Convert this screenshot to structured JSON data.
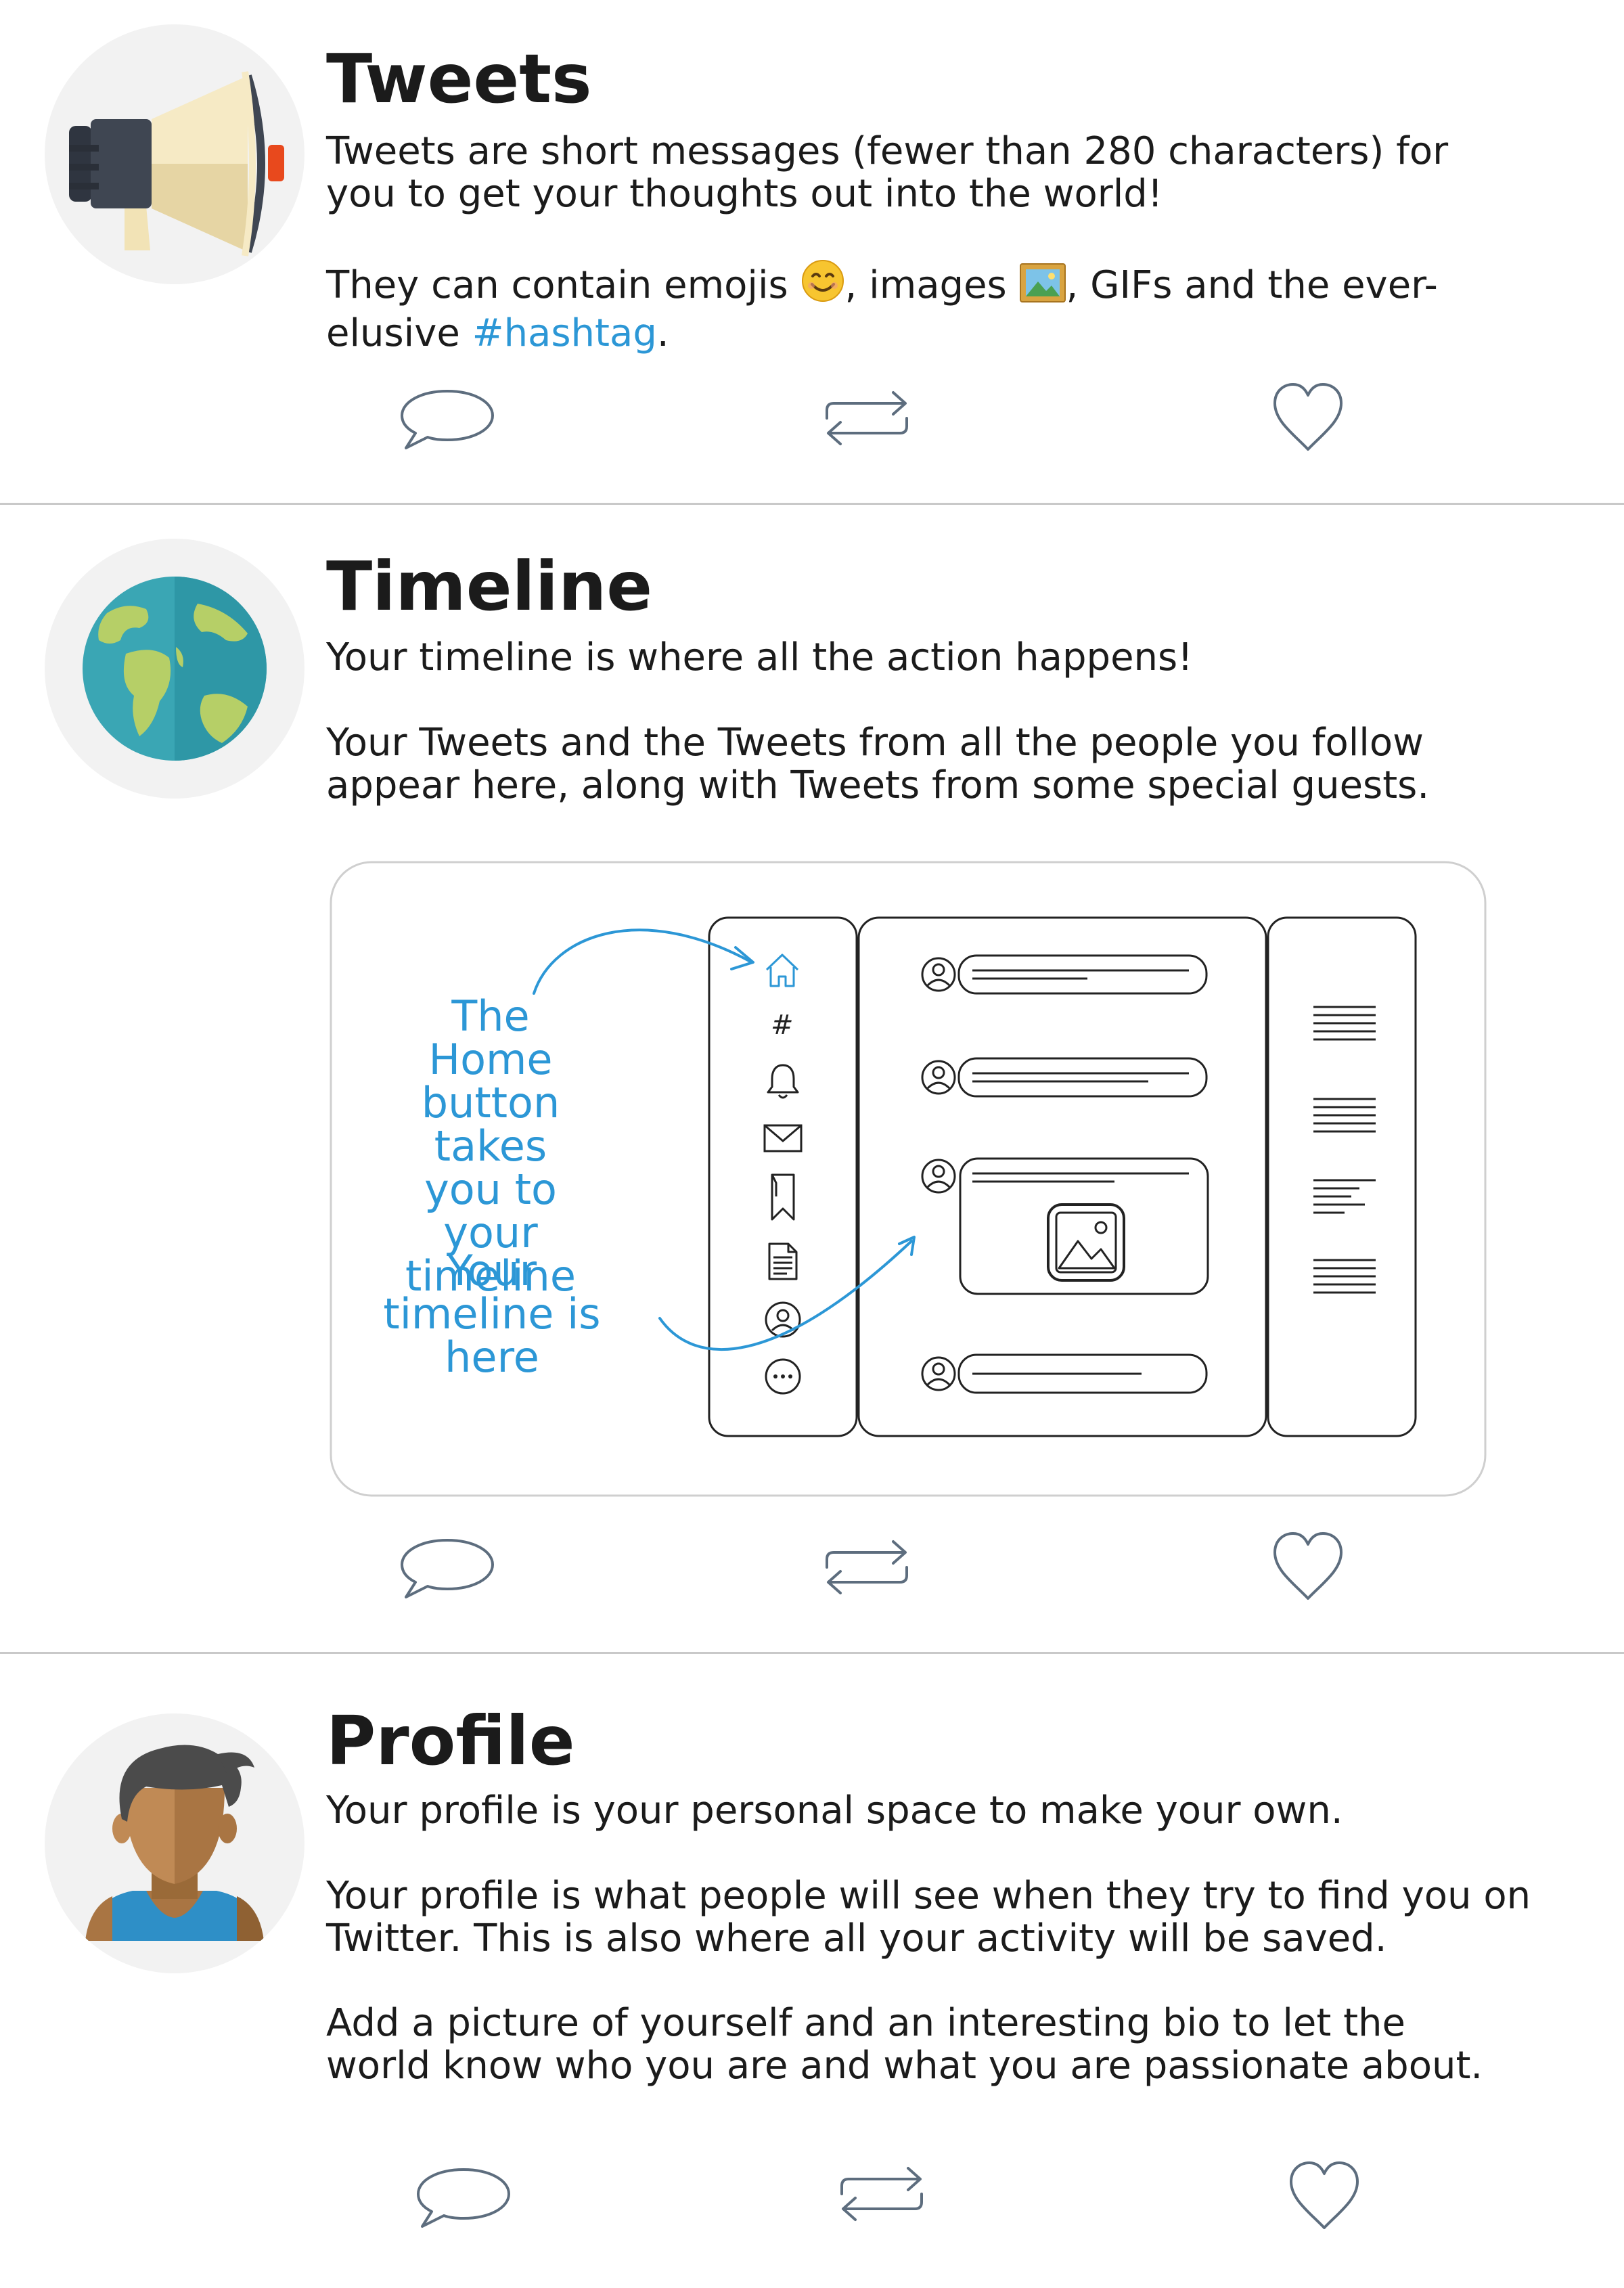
{
  "sections": {
    "tweets": {
      "title": "Tweets",
      "p1": "Tweets are short messages (fewer than 280 characters) for you to get your thoughts out into the world!",
      "p2_a": "They can contain emojis ",
      "p2_b": ", images ",
      "p2_c": ", GIFs and the ever-elusive ",
      "hashtag": "#hashtag",
      "p2_end": ".",
      "icon": "megaphone-icon"
    },
    "timeline": {
      "title": "Timeline",
      "p1": "Your timeline is where all the action happens!",
      "p2": "Your Tweets and the Tweets from all the people you follow appear here, along with Tweets from some special guests.",
      "icon": "globe-icon",
      "diagram": {
        "callout_home": "The Home button takes you to your timeline",
        "callout_timeline": "Your timeline is here",
        "nav_hashtag": "#"
      }
    },
    "profile": {
      "title": "Profile",
      "p1": "Your profile is your personal space to make your own.",
      "p2": "Your profile is what people will see when they try to find you on Twitter. This is also where all your activity will be saved.",
      "p3": "Add a picture of yourself and an interesting bio to let the world know who you are and what you are passionate about.",
      "icon": "person-avatar-icon"
    }
  },
  "action_icons": [
    "reply-bubble-icon",
    "retweet-icon",
    "heart-icon"
  ],
  "colors": {
    "accent": "#2c97d6",
    "text": "#1b1b1b",
    "icon_stroke": "#5d6d7e",
    "divider": "#c9c9c9"
  }
}
